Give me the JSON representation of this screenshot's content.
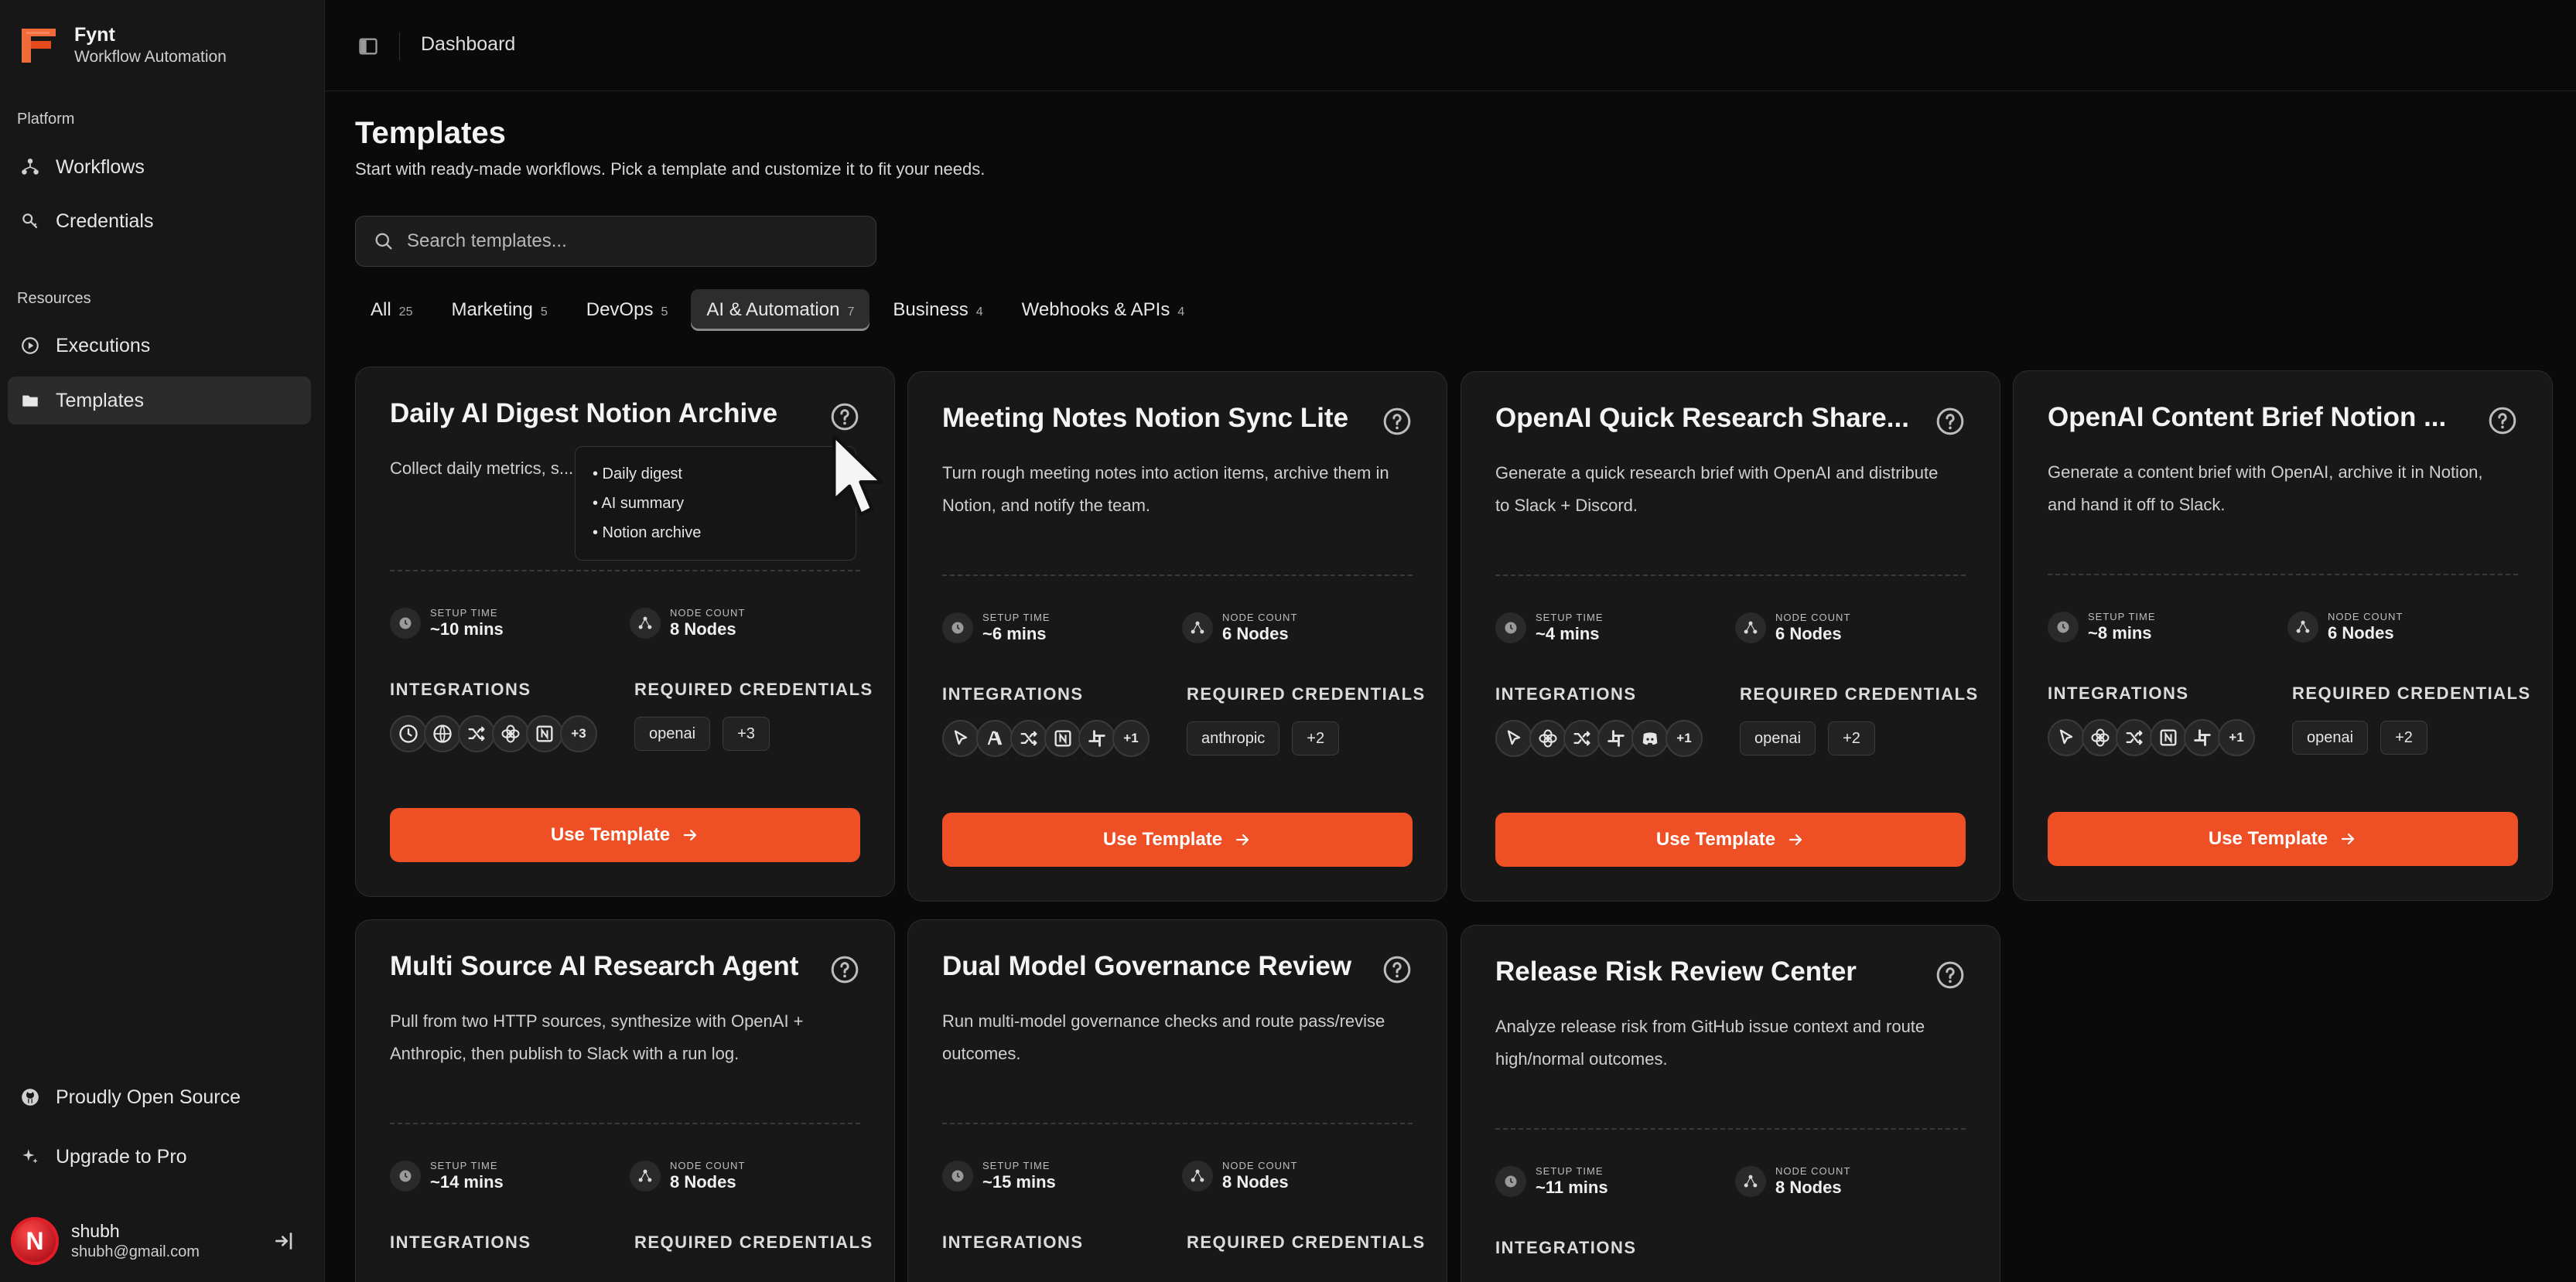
{
  "brand": {
    "name": "Fynt",
    "subtitle": "Workflow Automation"
  },
  "sidebar": {
    "platform_label": "Platform",
    "resources_label": "Resources",
    "items": [
      {
        "label": "Workflows",
        "icon": "workflow-icon"
      },
      {
        "label": "Credentials",
        "icon": "key-icon"
      },
      {
        "label": "Executions",
        "icon": "play-circle-icon"
      },
      {
        "label": "Templates",
        "icon": "folder-icon",
        "active": true
      }
    ],
    "bottom": [
      {
        "label": "Proudly Open Source",
        "icon": "github-icon"
      },
      {
        "label": "Upgrade to Pro",
        "icon": "sparkle-icon"
      }
    ],
    "user": {
      "initial": "N",
      "name": "shubh",
      "email": "shubh@gmail.com"
    }
  },
  "topbar": {
    "breadcrumb": "Dashboard"
  },
  "page": {
    "title": "Templates",
    "subtitle": "Start with ready-made workflows. Pick a template and customize it to fit your needs."
  },
  "search": {
    "placeholder": "Search templates...",
    "value": ""
  },
  "tabs": [
    {
      "label": "All",
      "count": "25"
    },
    {
      "label": "Marketing",
      "count": "5"
    },
    {
      "label": "DevOps",
      "count": "5"
    },
    {
      "label": "AI & Automation",
      "count": "7",
      "active": true
    },
    {
      "label": "Business",
      "count": "4"
    },
    {
      "label": "Webhooks & APIs",
      "count": "4"
    }
  ],
  "labels": {
    "setup_time": "SETUP TIME",
    "node_count": "NODE COUNT",
    "integrations": "INTEGRATIONS",
    "required_credentials": "REQUIRED CREDENTIALS",
    "use_template": "Use Template"
  },
  "tooltip": {
    "items": [
      "• Daily digest",
      "• AI summary",
      "• Notion archive"
    ]
  },
  "colors": {
    "accent": "#ef4f25",
    "background": "#0a0a0a",
    "card": "#181818",
    "sidebar": "#171717"
  },
  "cards": [
    {
      "title": "Daily AI Digest Notion Archive",
      "description": "Collect daily metrics, s... report in Notion, and n...",
      "setup_time": "~10 mins",
      "node_count": "8 Nodes",
      "integrations": [
        "clock-icon",
        "globe-icon",
        "shuffle-icon",
        "openai-icon",
        "notion-icon"
      ],
      "integrations_more": "+3",
      "credentials": [
        "openai"
      ],
      "credentials_more": "+3"
    },
    {
      "title": "Meeting Notes Notion Sync Lite",
      "description": "Turn rough meeting notes into action items, archive them in Notion, and notify the team.",
      "setup_time": "~6 mins",
      "node_count": "6 Nodes",
      "integrations": [
        "cursor-icon",
        "anthropic-icon",
        "shuffle-icon",
        "notion-icon",
        "slack-icon"
      ],
      "integrations_more": "+1",
      "credentials": [
        "anthropic"
      ],
      "credentials_more": "+2"
    },
    {
      "title": "OpenAI Quick Research Share...",
      "description": "Generate a quick research brief with OpenAI and distribute to Slack + Discord.",
      "setup_time": "~4 mins",
      "node_count": "6 Nodes",
      "integrations": [
        "cursor-icon",
        "openai-icon",
        "shuffle-icon",
        "slack-icon",
        "discord-icon"
      ],
      "integrations_more": "+1",
      "credentials": [
        "openai"
      ],
      "credentials_more": "+2"
    },
    {
      "title": "OpenAI Content Brief Notion ...",
      "description": "Generate a content brief with OpenAI, archive it in Notion, and hand it off to Slack.",
      "setup_time": "~8 mins",
      "node_count": "6 Nodes",
      "integrations": [
        "cursor-icon",
        "openai-icon",
        "shuffle-icon",
        "notion-icon",
        "slack-icon"
      ],
      "integrations_more": "+1",
      "credentials": [
        "openai"
      ],
      "credentials_more": "+2"
    },
    {
      "title": "Multi Source AI Research Agent",
      "description": "Pull from two HTTP sources, synthesize with OpenAI + Anthropic, then publish to Slack with a run log.",
      "setup_time": "~14 mins",
      "node_count": "8 Nodes"
    },
    {
      "title": "Dual Model Governance Review",
      "description": "Run multi-model governance checks and route pass/revise outcomes.",
      "setup_time": "~15 mins",
      "node_count": "8 Nodes"
    },
    {
      "title": "Release Risk Review Center",
      "description": "Analyze release risk from GitHub issue context and route high/normal outcomes.",
      "setup_time": "~11 mins",
      "node_count": "8 Nodes"
    }
  ]
}
